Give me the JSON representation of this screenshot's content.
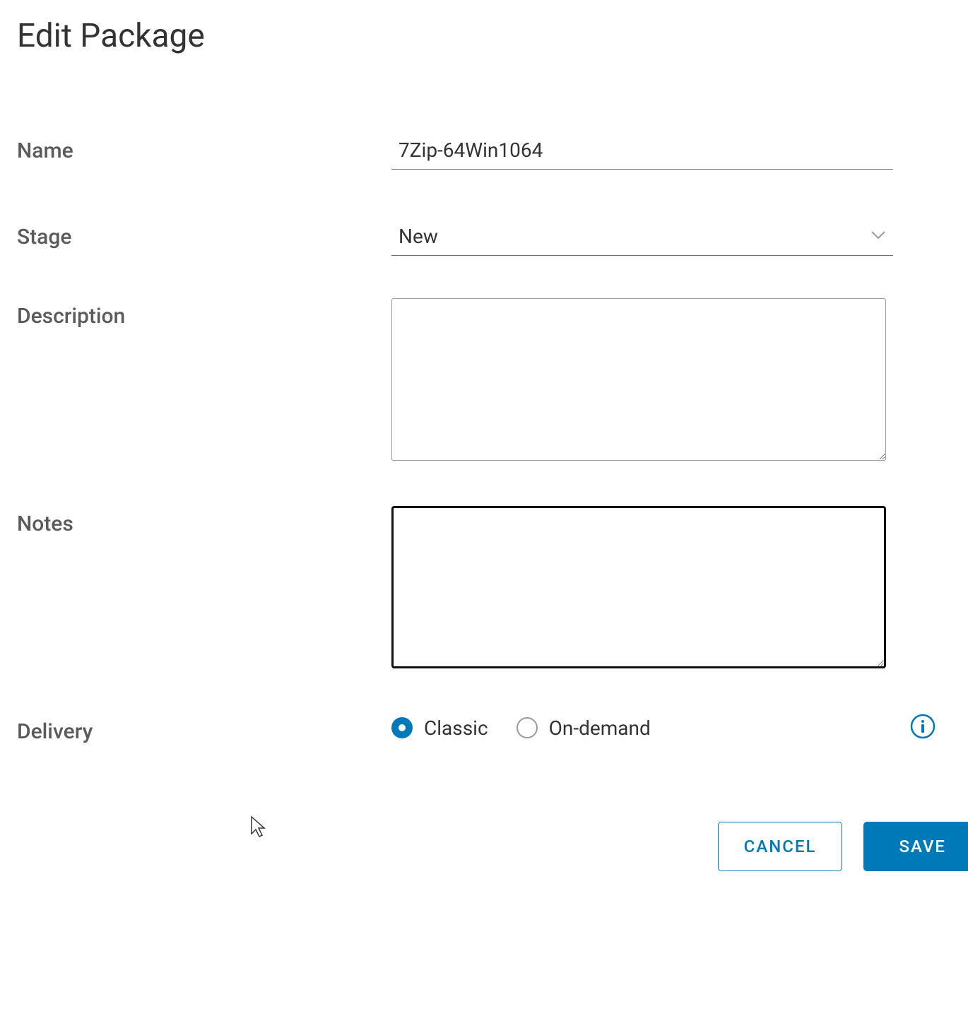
{
  "title": "Edit Package",
  "labels": {
    "name": "Name",
    "stage": "Stage",
    "description": "Description",
    "notes": "Notes",
    "delivery": "Delivery"
  },
  "fields": {
    "name_value": "7Zip-64Win1064",
    "stage_value": "New",
    "description_value": "",
    "notes_value": ""
  },
  "delivery": {
    "options": [
      {
        "label": "Classic",
        "selected": true
      },
      {
        "label": "On-demand",
        "selected": false
      }
    ]
  },
  "buttons": {
    "cancel": "CANCEL",
    "save": "SAVE"
  },
  "colors": {
    "primary": "#0079b8"
  }
}
